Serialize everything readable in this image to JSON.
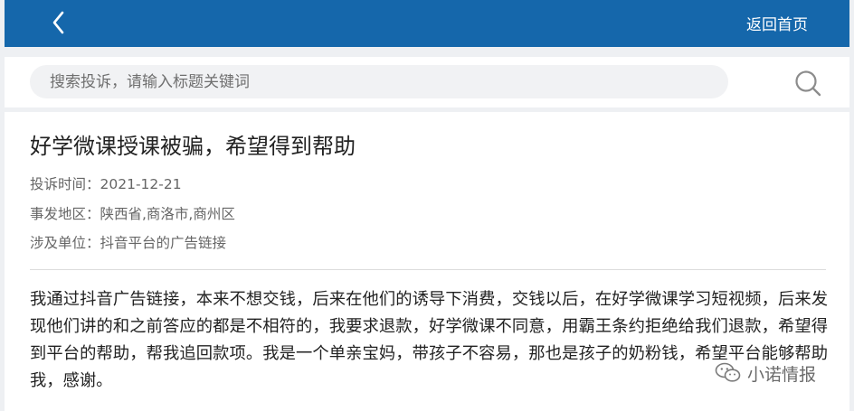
{
  "header": {
    "back_icon": "chevron-left-icon",
    "home_label": "返回首页",
    "background": "#1567ab"
  },
  "search": {
    "placeholder": "搜索投诉，请输入标题关键词",
    "icon": "search-icon"
  },
  "complaint": {
    "title": "好学微课授课被骗，希望得到帮助",
    "time_line": "投诉时间：2021-12-21",
    "region_line": "事发地区：陕西省,商洛市,商州区",
    "party_line": "涉及单位：抖音平台的广告链接",
    "body": "我通过抖音广告链接，本来不想交钱，后来在他们的诱导下消费，交钱以后，在好学微课学习短视频，后来发现他们讲的和之前答应的都是不相符的，我要求退款，好学微课不同意，用霸王条约拒绝给我们退款，希望得到平台的帮助，帮我追回款项。我是一个单亲宝妈，带孩子不容易，那也是孩子的奶粉钱，希望平台能够帮助我，感谢。"
  },
  "watermark": {
    "text": "小诺情报",
    "icon": "wechat-icon"
  }
}
